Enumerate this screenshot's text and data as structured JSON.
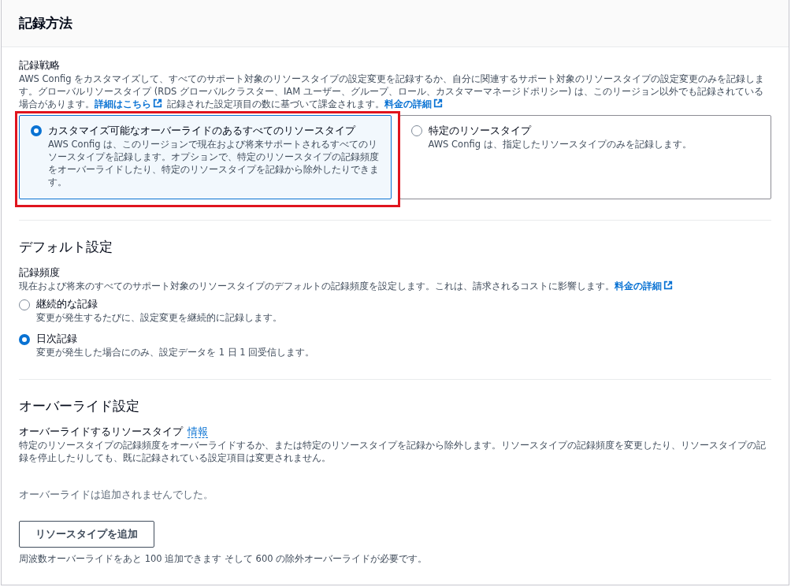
{
  "header": {
    "title": "記録方法"
  },
  "strategy": {
    "label": "記録戦略",
    "description": [
      {
        "kind": "text",
        "text": "AWS Config をカスタマイズして、すべてのサポート対象のリソースタイプの設定変更を記録するか、自分に関連するサポート対象のリソースタイプの設定変更のみを記録します。グローバルリソースタイプ (RDS グローバルクラスター、IAM ユーザー、グループ、ロール、カスタマーマネージドポリシー) は、このリージョン以外でも記録されている場合があります。"
      },
      {
        "kind": "external-link",
        "text": "詳細はこちら"
      },
      {
        "kind": "text",
        "text": " 記録された設定項目の数に基づいて課金されます。"
      },
      {
        "kind": "external-link",
        "text": "料金の詳細"
      }
    ],
    "tiles": [
      {
        "title": "カスタマイズ可能なオーバーライドのあるすべてのリソースタイプ",
        "description": "AWS Config は、このリージョンで現在および将来サポートされるすべてのリソースタイプを記録します。オプションで、特定のリソースタイプの記録頻度をオーバーライドしたり、特定のリソースタイプを記録から除外したりできます。",
        "selected": true,
        "highlighted": true
      },
      {
        "title": "特定のリソースタイプ",
        "description": "AWS Config は、指定したリソースタイプのみを記録します。",
        "selected": false,
        "highlighted": false
      }
    ]
  },
  "default_settings": {
    "title": "デフォルト設定",
    "label": "記録頻度",
    "description": [
      {
        "kind": "text",
        "text": "現在および将来のすべてのサポート対象のリソースタイプのデフォルトの記録頻度を設定します。これは、請求されるコストに影響します。"
      },
      {
        "kind": "external-link",
        "text": "料金の詳細"
      }
    ],
    "options": [
      {
        "label": "継続的な記録",
        "description": "変更が発生するたびに、設定変更を継続的に記録します。",
        "selected": false
      },
      {
        "label": "日次記録",
        "description": "変更が発生した場合にのみ、設定データを 1 日 1 回受信します。",
        "selected": true
      }
    ]
  },
  "override_settings": {
    "title": "オーバーライド設定",
    "label": "オーバーライドするリソースタイプ",
    "info": "情報",
    "description": "特定のリソースタイプの記録頻度をオーバーライドするか、または特定のリソースタイプを記録から除外します。リソースタイプの記録頻度を変更したり、リソースタイプの記録を停止したりしても、既に記録されている設定項目は変更されません。",
    "empty_message": "オーバーライドは追加されませんでした。",
    "button": "リソースタイプを追加",
    "footer": "周波数オーバーライドをあと 100 追加できます そして 600 の除外オーバーライドが必要です。"
  }
}
